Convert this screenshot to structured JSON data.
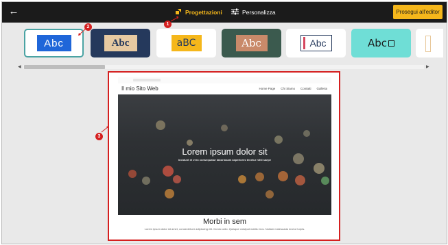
{
  "topbar": {
    "tabs": [
      {
        "label": "Progettazioni",
        "icon": "pencil-ruler-icon",
        "active": true
      },
      {
        "label": "Personalizza",
        "icon": "sliders-icon",
        "active": false
      }
    ],
    "cta_label": "Prosegui all'editor"
  },
  "colors": {
    "accent": "#f5b71b",
    "annotation": "#d51f1f",
    "topbar": "#1b1b1b"
  },
  "annotations": [
    "1",
    "2",
    "3"
  ],
  "font_styles": [
    {
      "text": "Abc",
      "bg": "#ffffff",
      "swatch_bg": "#1f66d9",
      "fg": "#ffffff",
      "selected": true
    },
    {
      "text": "Abc",
      "bg": "#25395c",
      "swatch_bg": "#e6c9a1",
      "fg": "#25395c"
    },
    {
      "text": "aBC",
      "bg": "#ffffff",
      "swatch_bg": "#f5b71b",
      "fg": "#25395c"
    },
    {
      "text": "Abc",
      "bg": "#3b5a4e",
      "swatch_bg": "#c98a6a",
      "fg": "#ffffff"
    },
    {
      "text": "Abc",
      "bg": "#ffffff",
      "swatch_bg": "#ffffff",
      "fg": "#25395c"
    },
    {
      "text": "Abc",
      "bg": "#6fded6",
      "swatch_bg": "#6fded6",
      "fg": "#1b1b1b"
    }
  ],
  "preview": {
    "site_name": "Il mio Sito Web",
    "nav": [
      "Home Page",
      "Chi Siamo",
      "Contatti",
      "Galleria"
    ],
    "hero_title": "Lorem ipsum dolor sit",
    "hero_subtitle": "Incidunt et vero consequatur laboriosam asperiores tenetur nihil saepe",
    "section_title": "Morbi in sem",
    "section_text": "Lorem ipsum dolor sit amet, consectetuer adipiscing elit. Donec odio. Quisque volutpat mattis eros. Nullam malesuada erat ut turpis."
  }
}
